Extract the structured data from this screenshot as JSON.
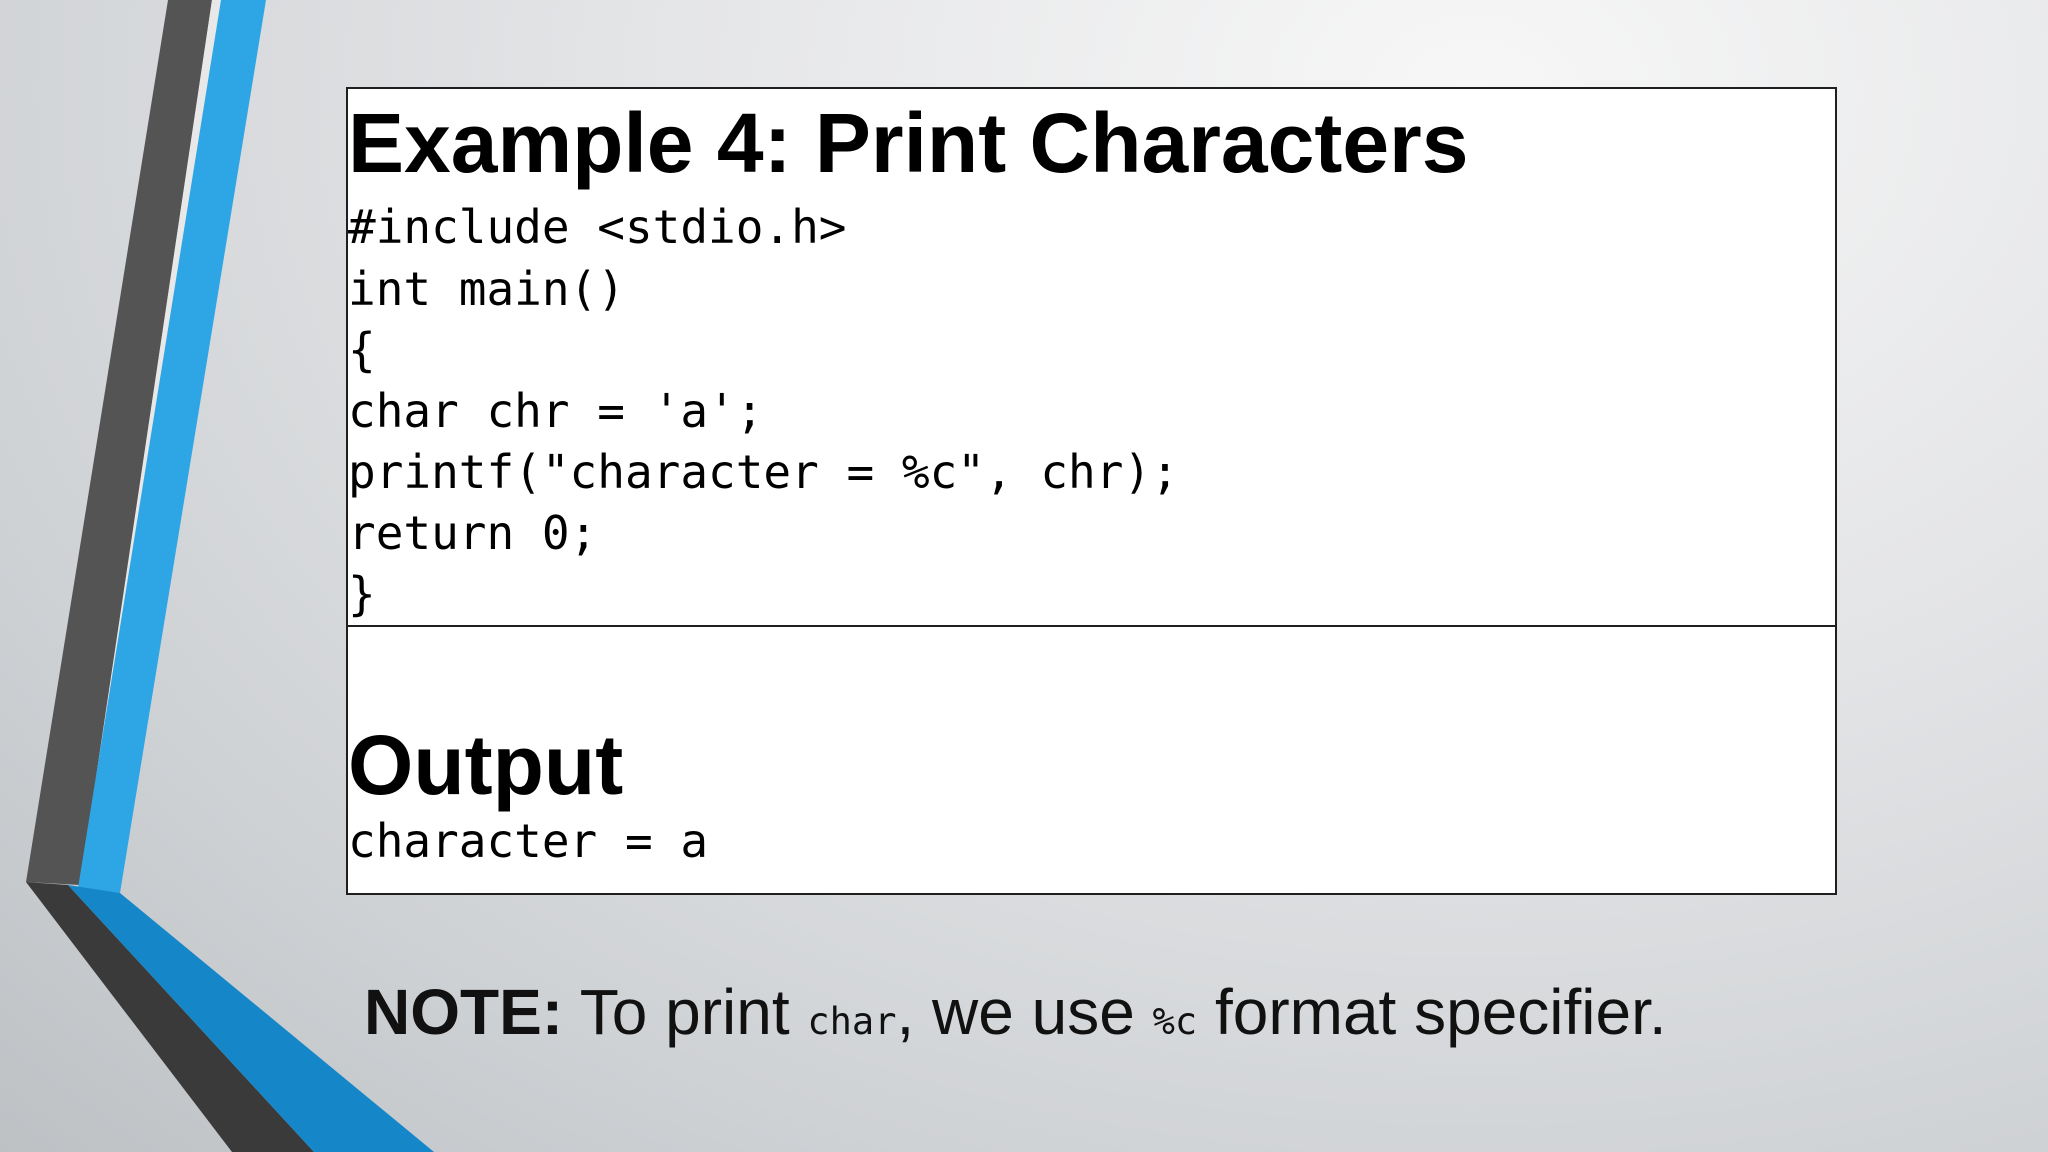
{
  "slide": {
    "title": "Example 4: Print Characters",
    "code_lines": [
      "#include <stdio.h>",
      "int main()",
      "{",
      "char chr = 'a';",
      "printf(\"character = %c\", chr);",
      "return 0;",
      "}"
    ],
    "output_heading": "Output",
    "output_text": "character = a",
    "note": {
      "label": "NOTE:",
      "text_1": " To print ",
      "code_1": "char",
      "text_2": ", we use ",
      "code_2": "%c",
      "text_3": " format specifier."
    }
  },
  "colors": {
    "accent_blue": "#2ea6e6",
    "dark_blue": "#1587c9",
    "dark_gray": "#545454",
    "charcoal": "#3a3a3a"
  }
}
